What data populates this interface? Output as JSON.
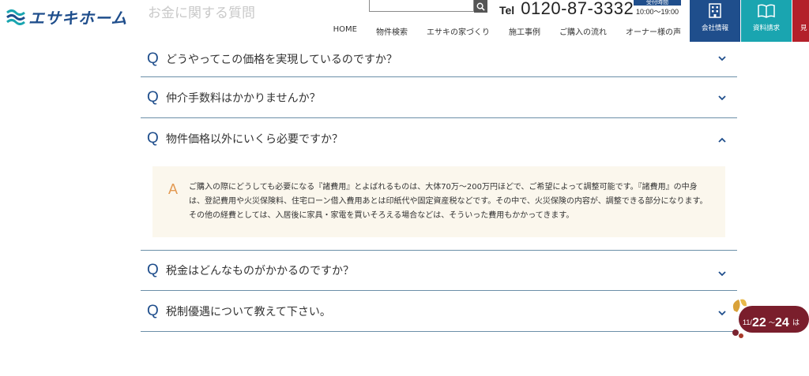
{
  "header": {
    "logo_text": "エサキホーム",
    "page_heading": "お金に関する質問",
    "search_placeholder": "",
    "tel_label": "Tel",
    "tel_number": "0120-87-3332",
    "hours_label": "受付時間",
    "hours_time": "10:00〜19:00"
  },
  "nav": [
    "HOME",
    "物件検索",
    "エサキの家づくり",
    "施工事例",
    "ご購入の流れ",
    "オーナー様の声"
  ],
  "top_buttons": {
    "company": "会社情報",
    "docs": "資料請求",
    "third": "見"
  },
  "faq": {
    "q_mark": "Q",
    "a_mark": "A",
    "items": [
      {
        "question": "どうやってこの価格を実現しているのですか？"
      },
      {
        "question": "仲介手数料はかかりませんか？"
      },
      {
        "question": "物件価格以外にいくら必要ですか？",
        "answer": "ご購入の際にどうしても必要になる『諸費用』とよばれるものは、大体70万〜200万円ほどで、ご希望によって調整可能です。『諸費用』の中身は、登記費用や火災保険料、住宅ローン借入費用あとは印紙代や固定資産税などです。その中で、火災保険の内容が、調整できる部分になります。その他の経費としては、入居後に家具・家電を買いそろえる場合などは、そういった費用もかかってきます。"
      },
      {
        "question": "税金はどんなものがかかるのですか？"
      },
      {
        "question": "税制優遇について教えて下さい。"
      }
    ]
  },
  "badge": {
    "month": "11/",
    "day1": "22",
    "sep": "〜",
    "day2": "24",
    "suffix": "は"
  },
  "colors": {
    "brand_blue": "#1f4e8c",
    "teal": "#1aa5b0",
    "red": "#b3202a",
    "answer_orange": "#e39a53",
    "answer_bg": "#fbf7ed"
  }
}
